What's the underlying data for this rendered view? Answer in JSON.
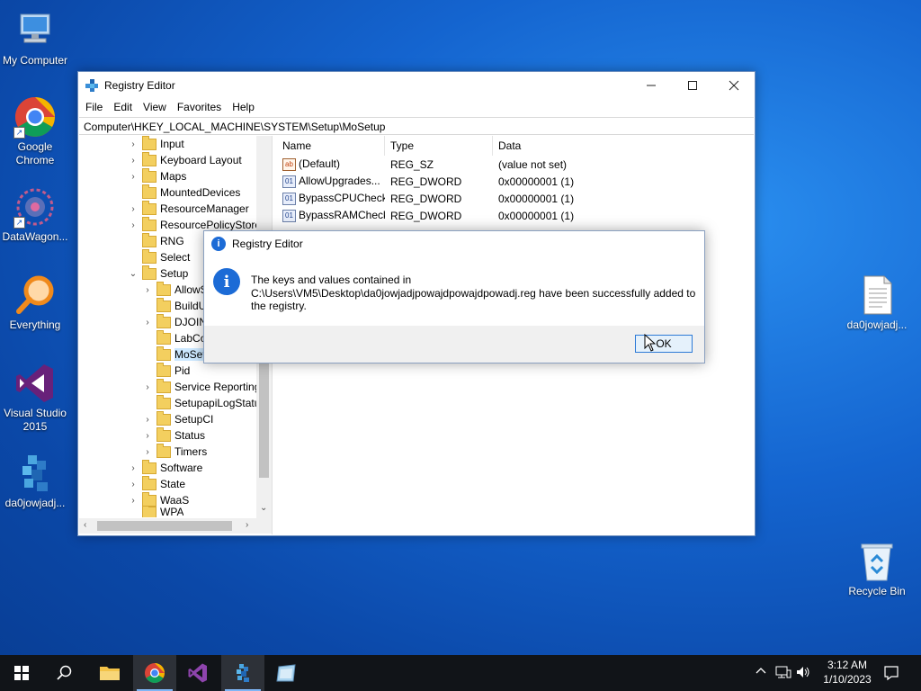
{
  "desktop": {
    "icons": [
      {
        "label": "My Computer",
        "icon": "computer-icon"
      },
      {
        "label": "Google Chrome",
        "icon": "chrome-icon"
      },
      {
        "label": "DataWagon...",
        "icon": "datawagon-icon"
      },
      {
        "label": "Everything",
        "icon": "everything-search-icon"
      },
      {
        "label": "Visual Studio 2015",
        "icon": "visual-studio-icon"
      },
      {
        "label": "da0jowjadj...",
        "icon": "reg-file-icon"
      },
      {
        "label": "da0jowjadj...",
        "icon": "text-file-icon"
      },
      {
        "label": "Recycle Bin",
        "icon": "recycle-bin-icon"
      }
    ]
  },
  "window": {
    "title": "Registry Editor",
    "menu": [
      "File",
      "Edit",
      "View",
      "Favorites",
      "Help"
    ],
    "address": "Computer\\HKEY_LOCAL_MACHINE\\SYSTEM\\Setup\\MoSetup",
    "tree": [
      {
        "label": "Input"
      },
      {
        "label": "Keyboard Layout"
      },
      {
        "label": "Maps"
      },
      {
        "label": "MountedDevices"
      },
      {
        "label": "ResourceManager"
      },
      {
        "label": "ResourcePolicyStore"
      },
      {
        "label": "RNG"
      },
      {
        "label": "Select"
      },
      {
        "label": "Setup"
      },
      {
        "label": "AllowS"
      },
      {
        "label": "BuildU"
      },
      {
        "label": "DJOIN"
      },
      {
        "label": "LabCo"
      },
      {
        "label": "MoSet"
      },
      {
        "label": "Pid"
      },
      {
        "label": "Service Reporting"
      },
      {
        "label": "SetupapiLogStatu"
      },
      {
        "label": "SetupCI"
      },
      {
        "label": "Status"
      },
      {
        "label": "Timers"
      },
      {
        "label": "Software"
      },
      {
        "label": "State"
      },
      {
        "label": "WaaS"
      },
      {
        "label": "WPA"
      }
    ],
    "columns": {
      "name": "Name",
      "type": "Type",
      "data": "Data"
    },
    "values": [
      {
        "name": "(Default)",
        "type": "REG_SZ",
        "data": "(value not set)",
        "icon": "ab"
      },
      {
        "name": "AllowUpgrades...",
        "type": "REG_DWORD",
        "data": "0x00000001 (1)",
        "icon": "01"
      },
      {
        "name": "BypassCPUCheck",
        "type": "REG_DWORD",
        "data": "0x00000001 (1)",
        "icon": "01"
      },
      {
        "name": "BypassRAMCheck",
        "type": "REG_DWORD",
        "data": "0x00000001 (1)",
        "icon": "01"
      }
    ]
  },
  "dialog": {
    "title": "Registry Editor",
    "message_line1": "The keys and values contained in",
    "message_line2": "C:\\Users\\VM5\\Desktop\\da0jowjadjpowajdpowajdpowadj.reg have been successfully added to",
    "message_line3": "the registry.",
    "ok_label": "OK"
  },
  "taskbar": {
    "time": "3:12 AM",
    "date": "1/10/2023"
  }
}
